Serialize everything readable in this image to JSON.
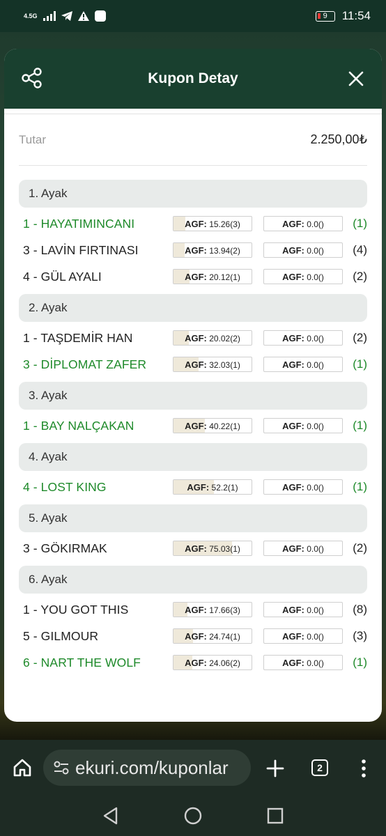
{
  "status_bar": {
    "network": "4.5G",
    "time": "11:54",
    "battery": "9"
  },
  "modal": {
    "title": "Kupon Detay",
    "amount_label": "Tutar",
    "amount_value": "2.250,00₺"
  },
  "agf_label": "AGF:",
  "legs": [
    {
      "label": "1. Ayak",
      "runners": [
        {
          "name": "1 - HAYATIMINCANI",
          "winner": true,
          "agf1": "15.26(3)",
          "agf1_pct": 15.26,
          "agf2": "0.0()",
          "rank": "(1)"
        },
        {
          "name": "3 - LAVİN FIRTINASI",
          "winner": false,
          "agf1": "13.94(2)",
          "agf1_pct": 13.94,
          "agf2": "0.0()",
          "rank": "(4)"
        },
        {
          "name": "4 - GÜL AYALI",
          "winner": false,
          "agf1": "20.12(1)",
          "agf1_pct": 20.12,
          "agf2": "0.0()",
          "rank": "(2)"
        }
      ]
    },
    {
      "label": "2. Ayak",
      "runners": [
        {
          "name": "1 - TAŞDEMİR HAN",
          "winner": false,
          "agf1": "20.02(2)",
          "agf1_pct": 20.02,
          "agf2": "0.0()",
          "rank": "(2)"
        },
        {
          "name": "3 - DİPLOMAT ZAFER",
          "winner": true,
          "agf1": "32.03(1)",
          "agf1_pct": 32.03,
          "agf2": "0.0()",
          "rank": "(1)"
        }
      ]
    },
    {
      "label": "3. Ayak",
      "runners": [
        {
          "name": "1 - BAY NALÇAKAN",
          "winner": true,
          "agf1": "40.22(1)",
          "agf1_pct": 40.22,
          "agf2": "0.0()",
          "rank": "(1)"
        }
      ]
    },
    {
      "label": "4. Ayak",
      "runners": [
        {
          "name": "4 - LOST KING",
          "winner": true,
          "agf1": "52.2(1)",
          "agf1_pct": 52.2,
          "agf2": "0.0()",
          "rank": "(1)"
        }
      ]
    },
    {
      "label": "5. Ayak",
      "runners": [
        {
          "name": "3 - GÖKIRMAK",
          "winner": false,
          "agf1": "75.03(1)",
          "agf1_pct": 75.03,
          "agf2": "0.0()",
          "rank": "(2)"
        }
      ]
    },
    {
      "label": "6. Ayak",
      "runners": [
        {
          "name": "1 - YOU GOT THIS",
          "winner": false,
          "agf1": "17.66(3)",
          "agf1_pct": 17.66,
          "agf2": "0.0()",
          "rank": "(8)"
        },
        {
          "name": "5 - GILMOUR",
          "winner": false,
          "agf1": "24.74(1)",
          "agf1_pct": 24.74,
          "agf2": "0.0()",
          "rank": "(3)"
        },
        {
          "name": "6 - NART THE WOLF",
          "winner": true,
          "agf1": "24.06(2)",
          "agf1_pct": 24.06,
          "agf2": "0.0()",
          "rank": "(1)"
        }
      ]
    }
  ],
  "browser": {
    "url": "ekuri.com/kuponlar",
    "tab_count": "2"
  },
  "colors": {
    "header_bg": "#19402f",
    "winner_text": "#1e8a2a",
    "leg_header_bg": "#e8ebea",
    "agf_fill": "#efe9da"
  }
}
